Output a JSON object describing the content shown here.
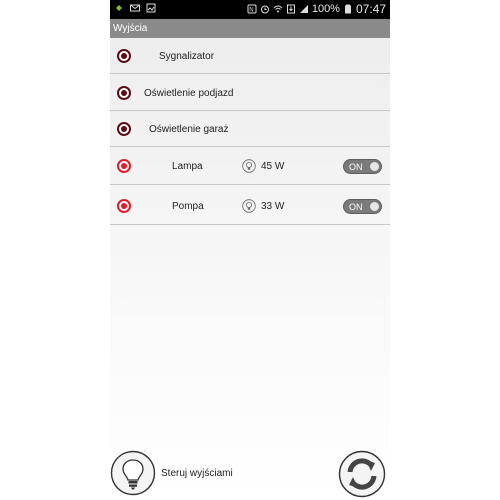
{
  "status_bar": {
    "battery_percent": "100%",
    "time": "07:47",
    "left_icons": [
      "android-icon",
      "mail-icon",
      "image-icon"
    ],
    "right_icons": [
      "nfc-icon",
      "alarm-icon",
      "wifi-icon",
      "download-icon",
      "signal-icon",
      "battery-icon"
    ]
  },
  "header": {
    "title": "Wyjścia"
  },
  "outputs": [
    {
      "label": "Sygnalizator",
      "status_color": "#5b0b14"
    },
    {
      "label": "Oświetlenie podjazd",
      "status_color": "#5b0b14"
    },
    {
      "label": "Oświetlenie garaż",
      "status_color": "#5b0b14"
    },
    {
      "label": "Lampa",
      "status_color": "#e21b2d",
      "power": "45 W",
      "toggle": "ON"
    },
    {
      "label": "Pompa",
      "status_color": "#e21b2d",
      "power": "33 W",
      "toggle": "ON"
    }
  ],
  "footer": {
    "control_label": "Steruj wyjściami"
  },
  "colors": {
    "status_bar": "#000000",
    "title_bar": "#8a8a8a",
    "toggle_on": "#7a7a7a"
  }
}
